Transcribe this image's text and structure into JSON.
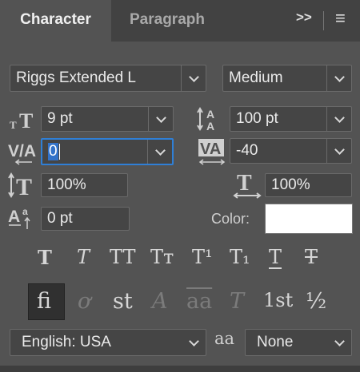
{
  "tabs": {
    "active": "Character",
    "inactive": "Paragraph"
  },
  "toolbar": {
    "expand_icon": ">>",
    "menu_icon": "≡"
  },
  "font": {
    "family": "Riggs Extended L",
    "style": "Medium"
  },
  "size": {
    "value": "9 pt"
  },
  "leading": {
    "value": "100 pt"
  },
  "kerning": {
    "value": "0"
  },
  "tracking": {
    "value": "-40"
  },
  "vertical_scale": {
    "value": "100%"
  },
  "horizontal_scale": {
    "value": "100%"
  },
  "baseline_shift": {
    "value": "0 pt"
  },
  "color": {
    "label": "Color:",
    "swatch": "#ffffff"
  },
  "style_buttons": [
    {
      "name": "faux-bold",
      "glyph": "T"
    },
    {
      "name": "faux-italic",
      "glyph": "T"
    },
    {
      "name": "all-caps",
      "glyph": "TT"
    },
    {
      "name": "small-caps",
      "glyph": "Tт"
    },
    {
      "name": "superscript",
      "glyph": "T¹"
    },
    {
      "name": "subscript",
      "glyph": "T₁"
    },
    {
      "name": "underline",
      "glyph": "T"
    },
    {
      "name": "strikethrough",
      "glyph": "T"
    }
  ],
  "opentype_buttons": [
    {
      "name": "standard-ligatures",
      "glyph": "fi"
    },
    {
      "name": "contextual-alternates",
      "glyph": "ơ"
    },
    {
      "name": "discretionary-ligatures",
      "glyph": "st"
    },
    {
      "name": "swash",
      "glyph": "A"
    },
    {
      "name": "stylistic-alternates",
      "glyph": "aa"
    },
    {
      "name": "titling-alternates",
      "glyph": "T"
    },
    {
      "name": "ordinals",
      "glyph": "1st"
    },
    {
      "name": "fractions",
      "glyph": "½"
    }
  ],
  "language": {
    "value": "English: USA"
  },
  "anti_alias": {
    "icon": "aa",
    "value": "None"
  }
}
